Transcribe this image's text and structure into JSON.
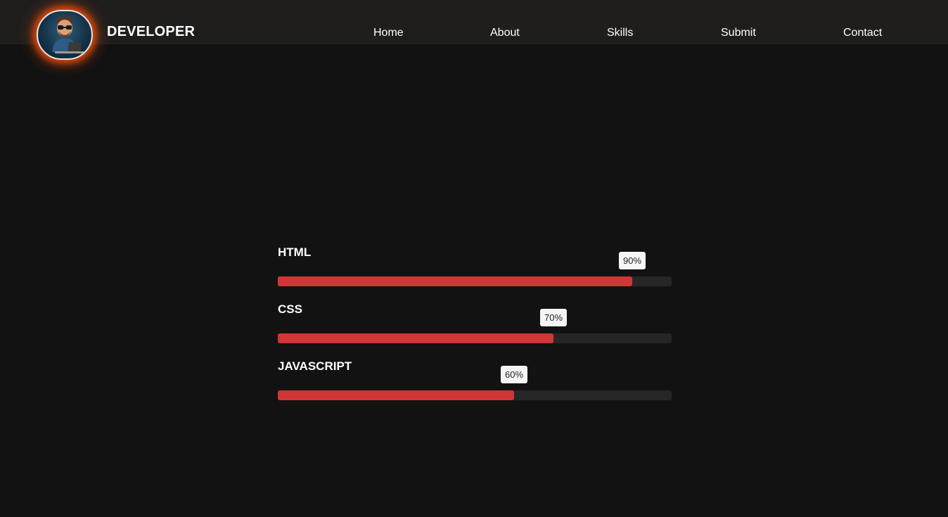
{
  "header": {
    "brand": "DEVELOPER",
    "avatar_alt": "developer avatar"
  },
  "nav": {
    "items": [
      {
        "label": "Home"
      },
      {
        "label": "About"
      },
      {
        "label": "Skills"
      },
      {
        "label": "Submit"
      },
      {
        "label": "Contact"
      }
    ]
  },
  "skills": [
    {
      "name": "HTML",
      "percent_label": "90%",
      "level": 90
    },
    {
      "name": "CSS",
      "percent_label": "70%",
      "level": 70
    },
    {
      "name": "JAVASCRIPT",
      "percent_label": "60%",
      "level": 60
    }
  ],
  "colors": {
    "bar_fill": "#d03636",
    "bar_track": "#262626",
    "avatar_glow": "#e04a0c",
    "background": "#121212",
    "topbar": "#1f1e1d"
  }
}
